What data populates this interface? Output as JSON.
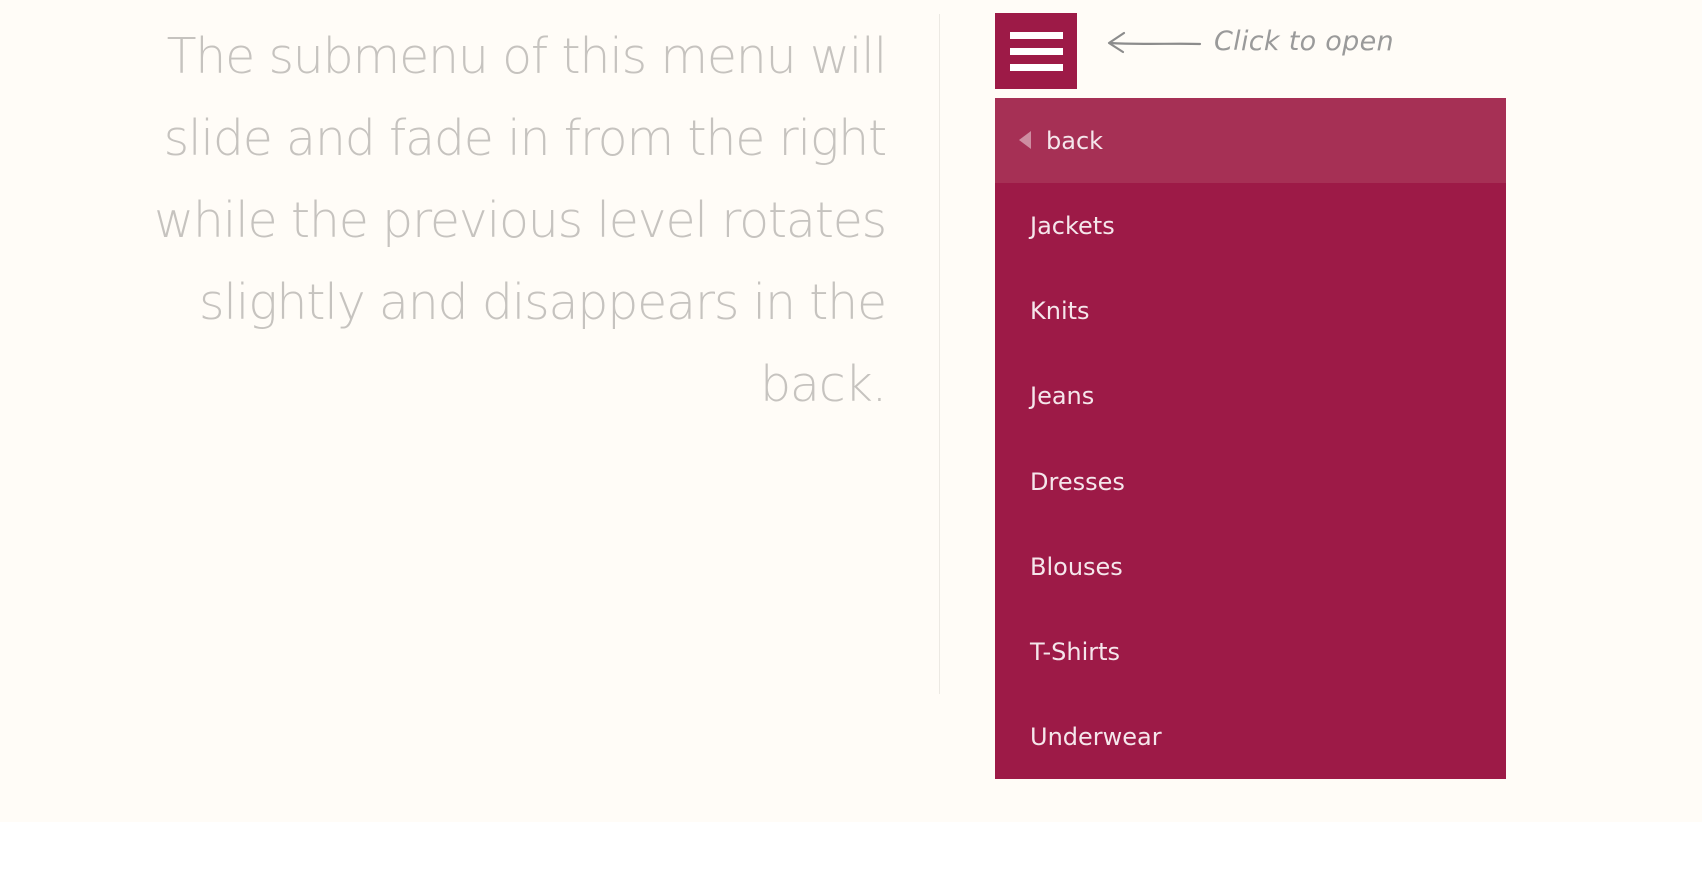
{
  "description": {
    "text": "The submenu of this menu will slide and fade in from the right while the previous level rotates slightly and disappears in the back."
  },
  "trigger": {
    "icon": "hamburger-menu-icon",
    "hint_label": "Click to open",
    "hint_icon": "arrow-left-icon"
  },
  "menu": {
    "back_label": "back",
    "back_icon": "triangle-left-icon",
    "items": [
      {
        "label": "Jackets"
      },
      {
        "label": "Knits"
      },
      {
        "label": "Jeans"
      },
      {
        "label": "Dresses"
      },
      {
        "label": "Blouses"
      },
      {
        "label": "T-Shirts"
      },
      {
        "label": "Underwear"
      }
    ]
  },
  "colors": {
    "background": "#fffcf7",
    "menu_accent": "#9d1a47",
    "menu_back_bg": "#a63055",
    "description_text": "#c6c3bf",
    "hint_text": "#9a9a9a"
  }
}
